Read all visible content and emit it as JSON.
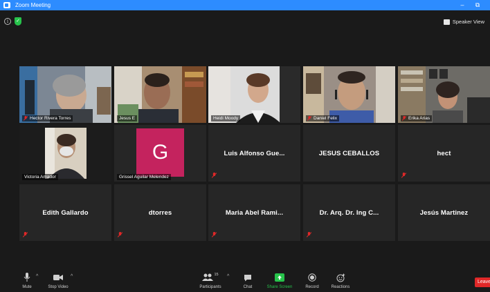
{
  "window": {
    "title": "Zoom Meeting",
    "minimize": "–",
    "restore": "⧉"
  },
  "header": {
    "speaker_view_label": "Speaker View"
  },
  "participants_row1": [
    {
      "name": "Hector Rivera Torres",
      "muted": true
    },
    {
      "name": "Jesus E",
      "muted": false
    },
    {
      "name": "Heidi Moody",
      "muted": false
    },
    {
      "name": "Daniel Felix",
      "muted": true
    },
    {
      "name": "Erika Arias",
      "muted": true
    }
  ],
  "victoria": {
    "name": "Victoria Amador"
  },
  "grissel": {
    "name": "Grissel Aguilar Melendez",
    "initial": "G",
    "avatar_color": "#c4235e"
  },
  "text_tiles": [
    {
      "name": "Luis Alfonso Gue...",
      "muted": true
    },
    {
      "name": "JESUS CEBALLOS",
      "muted": false
    },
    {
      "name": "hect",
      "muted": true
    },
    {
      "name": "Edith Gallardo",
      "muted": true
    },
    {
      "name": "dtorres",
      "muted": true
    },
    {
      "name": "Maria Abel Rami...",
      "muted": true
    },
    {
      "name": "Dr. Arq. Dr. Ing C...",
      "muted": true
    },
    {
      "name": "Jesús Martinez",
      "muted": false
    }
  ],
  "toolbar": {
    "mute": "Mute",
    "stop_video": "Stop Video",
    "participants": "Participants",
    "participants_count": "15",
    "chat": "Chat",
    "share_screen": "Share Screen",
    "record": "Record",
    "reactions": "Reactions",
    "leave": "Leave",
    "share_color": "#27c34b",
    "leave_color": "#e02828"
  }
}
